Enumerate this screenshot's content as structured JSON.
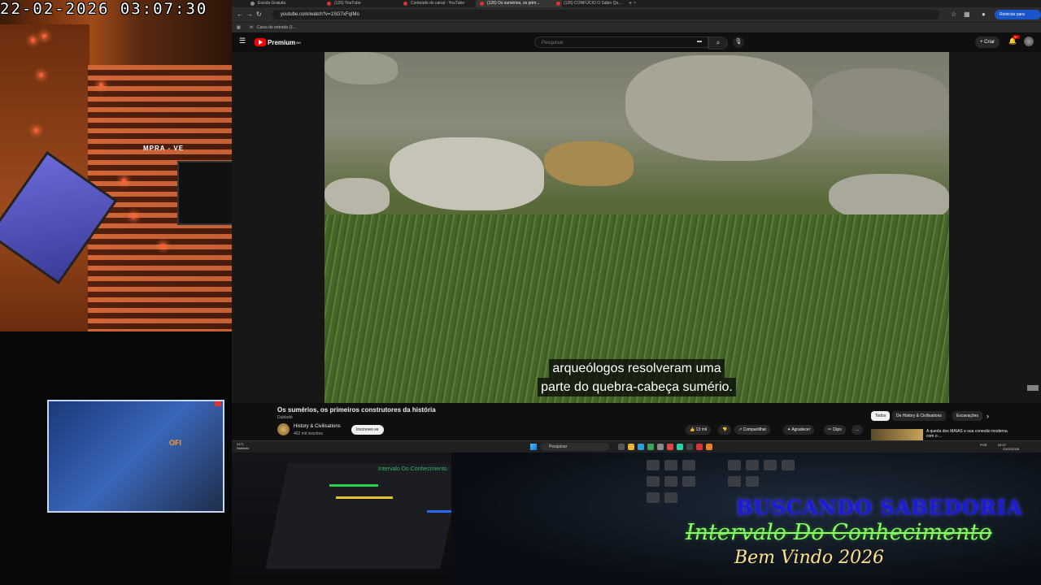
{
  "webcam": {
    "timestamp": "22-02-2026  03:07:30",
    "sign_text": "MPRA - VE",
    "mini_sign": "OFI"
  },
  "overlay": {
    "title": "BUSCANDO SABEDORIA",
    "subtitle": "Intervalo Do Conhecimento",
    "welcome": "Bem Vindo 2026"
  },
  "mixer_label": "Intervalo Do Conhecimento",
  "browser": {
    "tabs": [
      {
        "label": "Escola Gratuita",
        "active": false
      },
      {
        "label": "(126) YouTube",
        "active": false
      },
      {
        "label": "Conteúdo do canal - YouTube",
        "active": false
      },
      {
        "label": "(126) Os sumérios, os prim...",
        "active": true
      },
      {
        "label": "(126) CONFÚCIO O Sábio Qu...",
        "active": false
      }
    ],
    "new_tab": "+",
    "url": "youtube.com/watch?v=1SG7xFqIMo",
    "restart_label": "Reiniciar para atualizar",
    "bookmark": "Caixa de entrada (1...",
    "colors": {
      "accent": "#ff0000",
      "restart": "#1a56c9"
    }
  },
  "youtube": {
    "logo_text": "Premium",
    "logo_badge": "BR",
    "search_placeholder": "Pesquisar",
    "create_label": "+ Criar",
    "notification_count": "9+",
    "caption_line1": "arqueólogos resolveram uma",
    "caption_line2": "parte do quebra-cabeça sumério.",
    "video_title": "Os sumérios, os primeiros construtores da história",
    "dubbed": "Dublado",
    "channel": "History & Civilisations",
    "subscribers": "462 mil inscritos",
    "subscribe": "Inscrever-se",
    "likes": "13 mil",
    "share": "Compartilhar",
    "thanks": "Agradecer",
    "clips": "Clips",
    "more": "...",
    "chips": [
      "Todos",
      "De History & Civilisations",
      "Escavações"
    ],
    "chip_next": "›",
    "recommend_text": "A queda dos MAIAS e sua conexão moderna com o ..."
  },
  "taskbar": {
    "temperature": "24°C",
    "weather": "Nublado",
    "search": "Pesquisar",
    "lang": "POR",
    "time": "03:07",
    "date": "22/02/2026"
  }
}
